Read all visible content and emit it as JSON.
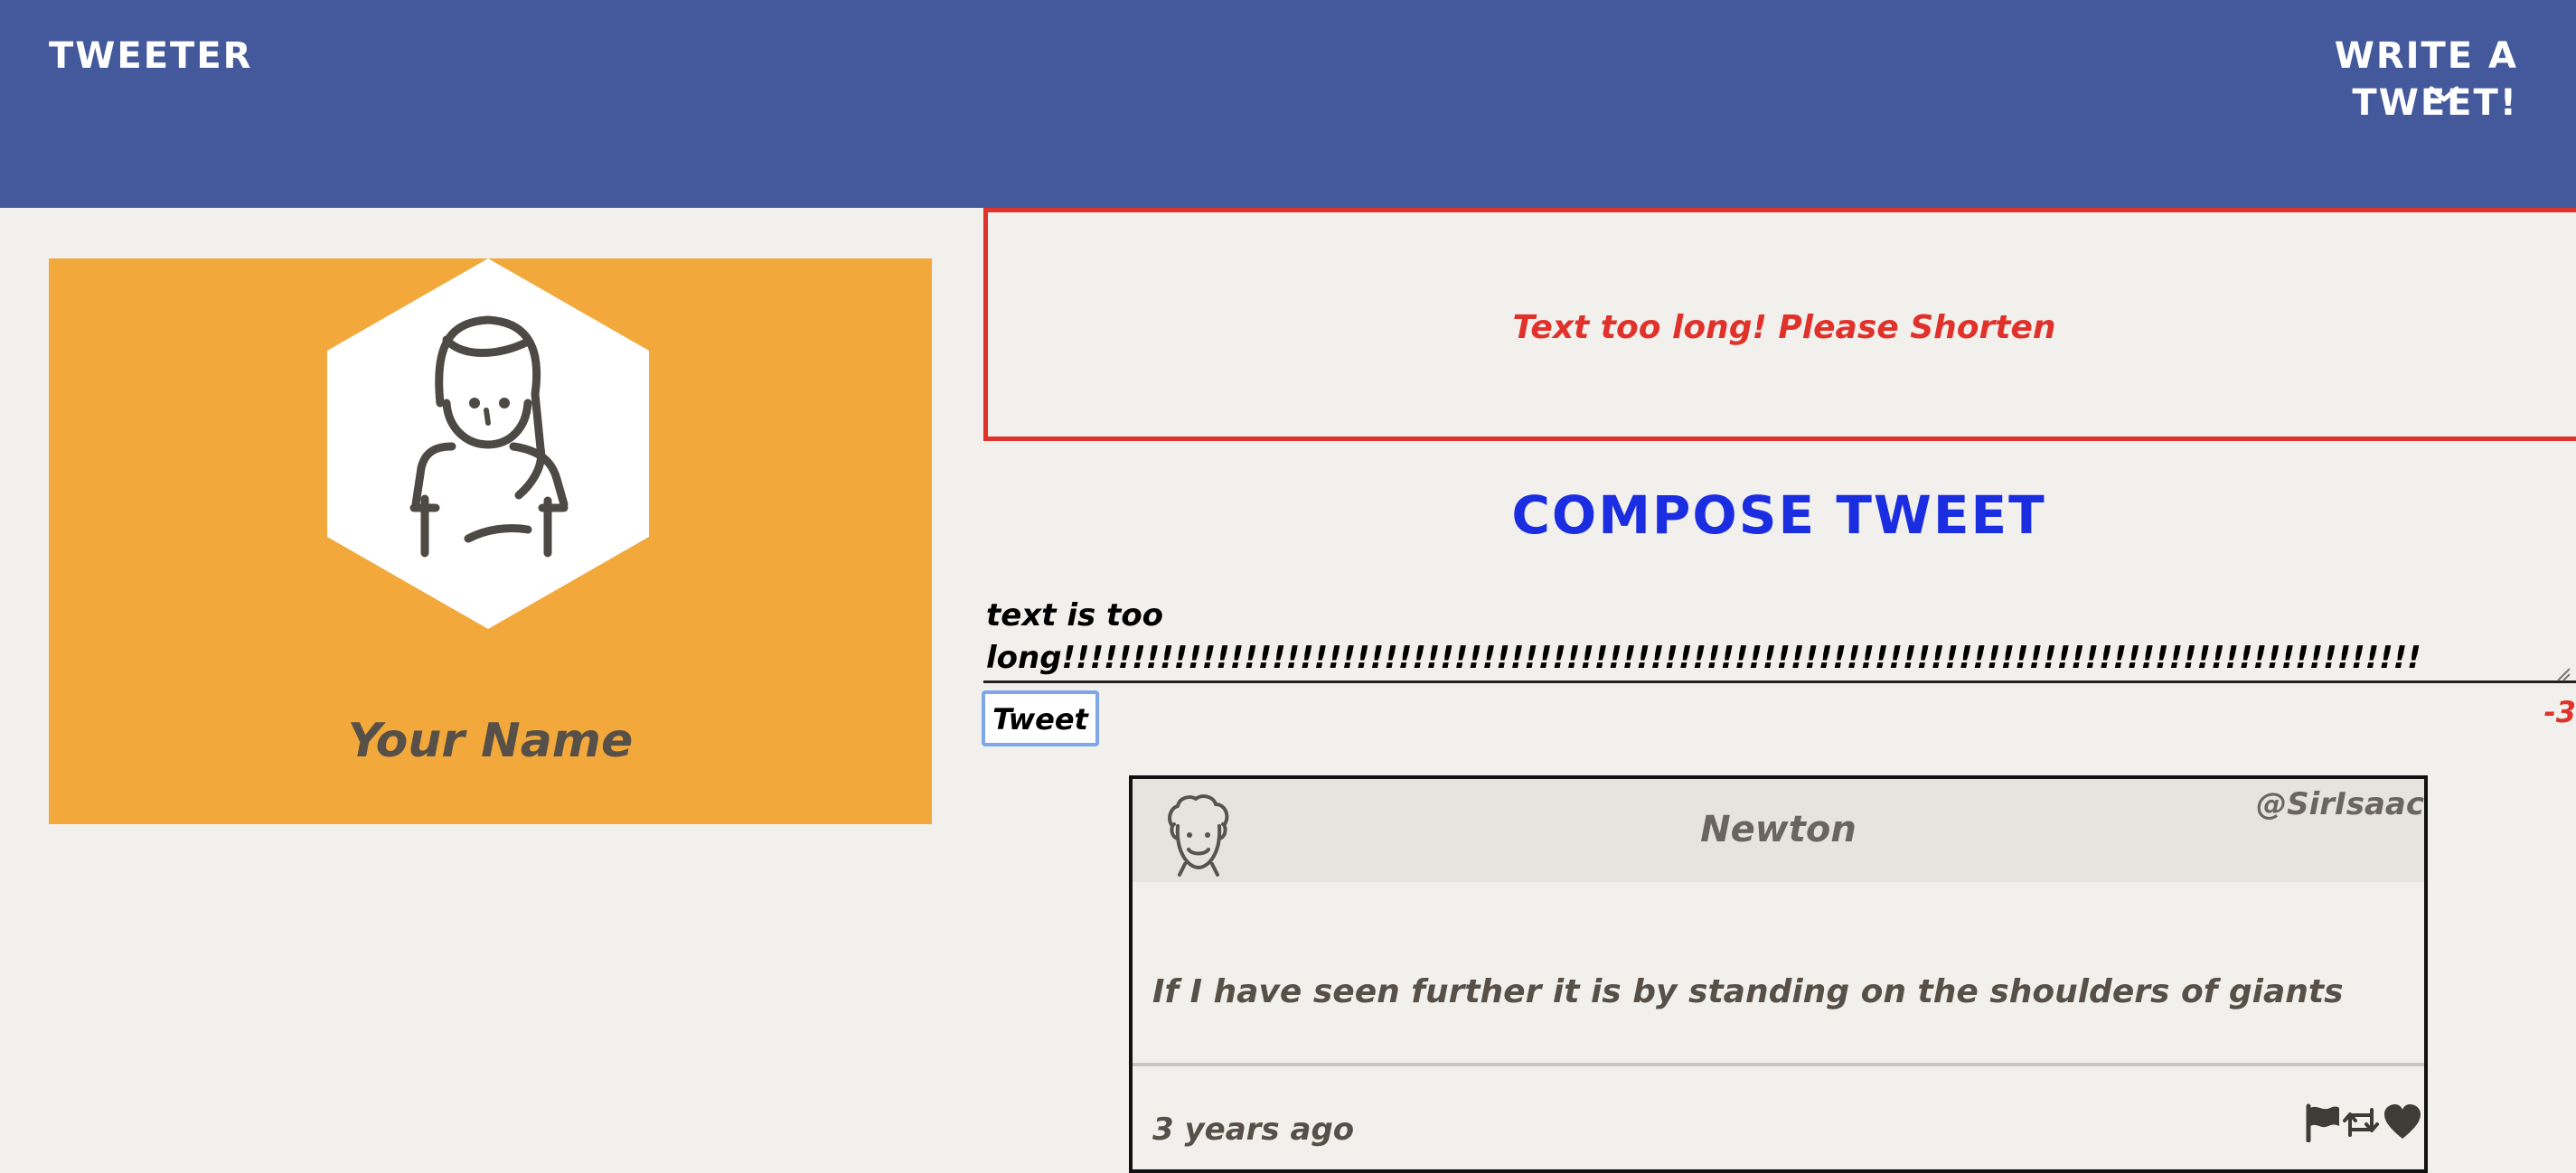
{
  "header": {
    "brand": "TWEETER",
    "compose_toggle_label": "WRITE A TWEET!"
  },
  "profile": {
    "name": "Your Name",
    "avatar_icon": "woman-avatar-icon",
    "card_color": "#f2a83b"
  },
  "compose": {
    "error_message": "Text too long! Please Shorten",
    "title": "COMPOSE TWEET",
    "text_line1": "text is too",
    "text_line2": "long!!!!!!!!!!!!!!!!!!!!!!!!!!!!!!!!!!!!!!!!!!!!!!!!!!!!!!!!!!!!!!!!!!!!!!!!!!!!!!!!!!!!!!!!!!!!!!!!!",
    "submit_label": "Tweet",
    "char_counter": "-3"
  },
  "tweets": [
    {
      "author": "Newton",
      "handle": "@SirIsaac",
      "content": "If I have seen further it is by standing on the shoulders of giants",
      "time": "3 years ago",
      "actions": [
        "flag-icon",
        "retweet-icon",
        "heart-icon"
      ]
    }
  ],
  "colors": {
    "navbar": "#44599c",
    "error": "#e0312a",
    "compose_title": "#1b2de0",
    "page_background": "#f2f0ec"
  }
}
